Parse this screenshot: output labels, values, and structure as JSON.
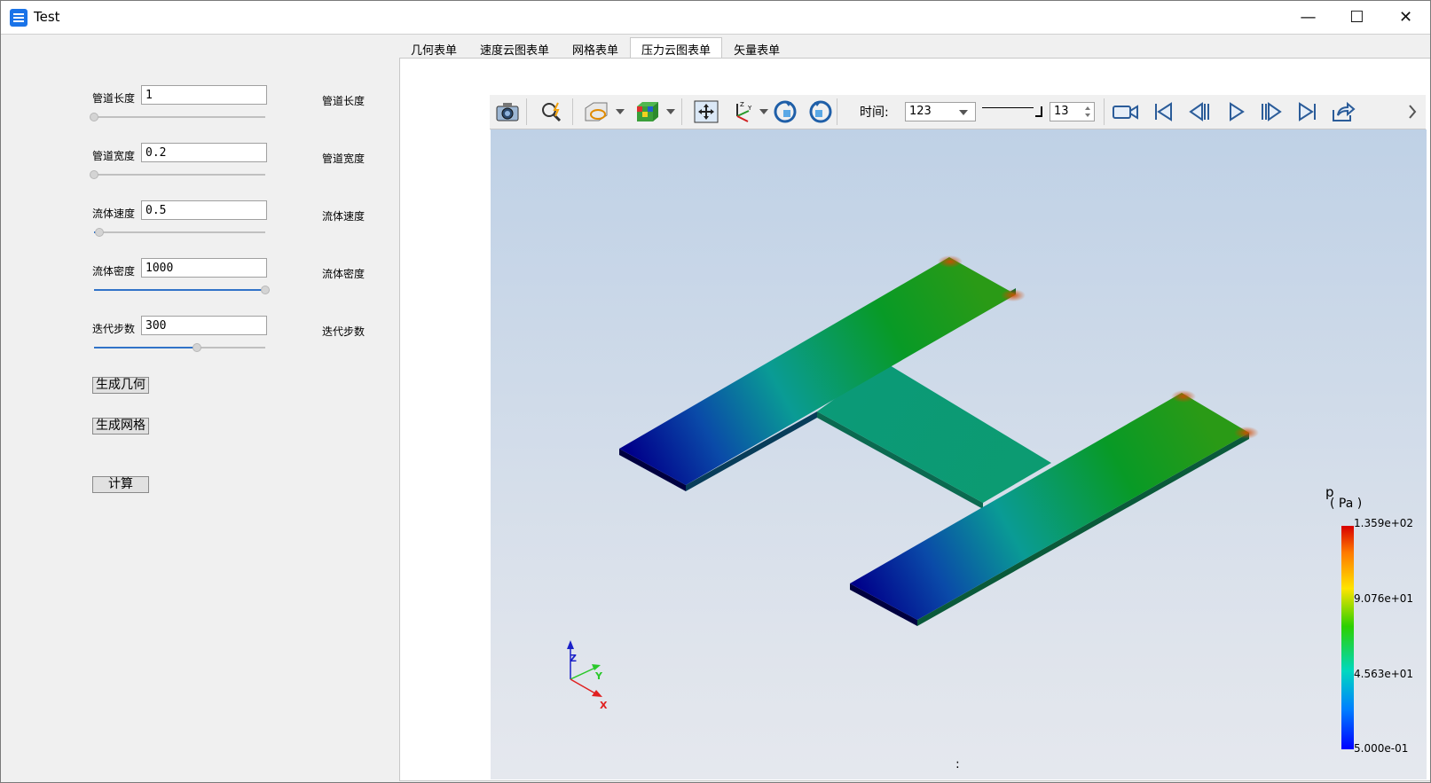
{
  "window": {
    "title": "Test",
    "controls": [
      "—",
      "☐",
      "✕"
    ]
  },
  "left_panel": {
    "rows": [
      {
        "label": "管道长度",
        "value": "1",
        "right_label": "管道长度",
        "slider_fraction": 0.0
      },
      {
        "label": "管道宽度",
        "value": "0.2",
        "right_label": "管道宽度",
        "slider_fraction": 0.0
      },
      {
        "label": "流体速度",
        "value": "0.5",
        "right_label": "流体速度",
        "slider_fraction": 0.03
      },
      {
        "label": "流体密度",
        "value": "1000",
        "right_label": "流体密度",
        "slider_fraction": 1.0
      },
      {
        "label": "迭代步数",
        "value": "300",
        "right_label": "迭代步数",
        "slider_fraction": 0.6
      }
    ],
    "buttons": {
      "gen_geometry": "生成几何",
      "gen_mesh": "生成网格",
      "compute": "计算"
    }
  },
  "tabs": [
    {
      "label": "几何表单",
      "active": false
    },
    {
      "label": "速度云图表单",
      "active": false
    },
    {
      "label": "网格表单",
      "active": false
    },
    {
      "label": "压力云图表单",
      "active": true
    },
    {
      "label": "矢量表单",
      "active": false
    }
  ],
  "toolbar": {
    "icons": [
      "camera-icon",
      "zoom-magic-icon",
      "box-select-icon",
      "color-cube-icon",
      "fit-view-icon",
      "axes-icon",
      "rotate-cw-icon",
      "rotate-ccw-icon",
      "video-camera-icon",
      "first-frame-icon",
      "prev-frame-icon",
      "play-icon",
      "next-frame-icon",
      "last-frame-icon",
      "export-icon"
    ],
    "time_label": "时间:",
    "time_value": "123",
    "frame_value": "13"
  },
  "viewer": {
    "legend": {
      "variable": "p",
      "unit": "( Pa )",
      "ticks": [
        "1.359e+02",
        "9.076e+01",
        "4.563e+01",
        "5.000e-01"
      ]
    },
    "axes": {
      "z": "Z",
      "y": "Y",
      "x": "X"
    },
    "status": ":"
  },
  "colors": {
    "accent": "#3173c8",
    "bg": "#f0f0f0"
  }
}
